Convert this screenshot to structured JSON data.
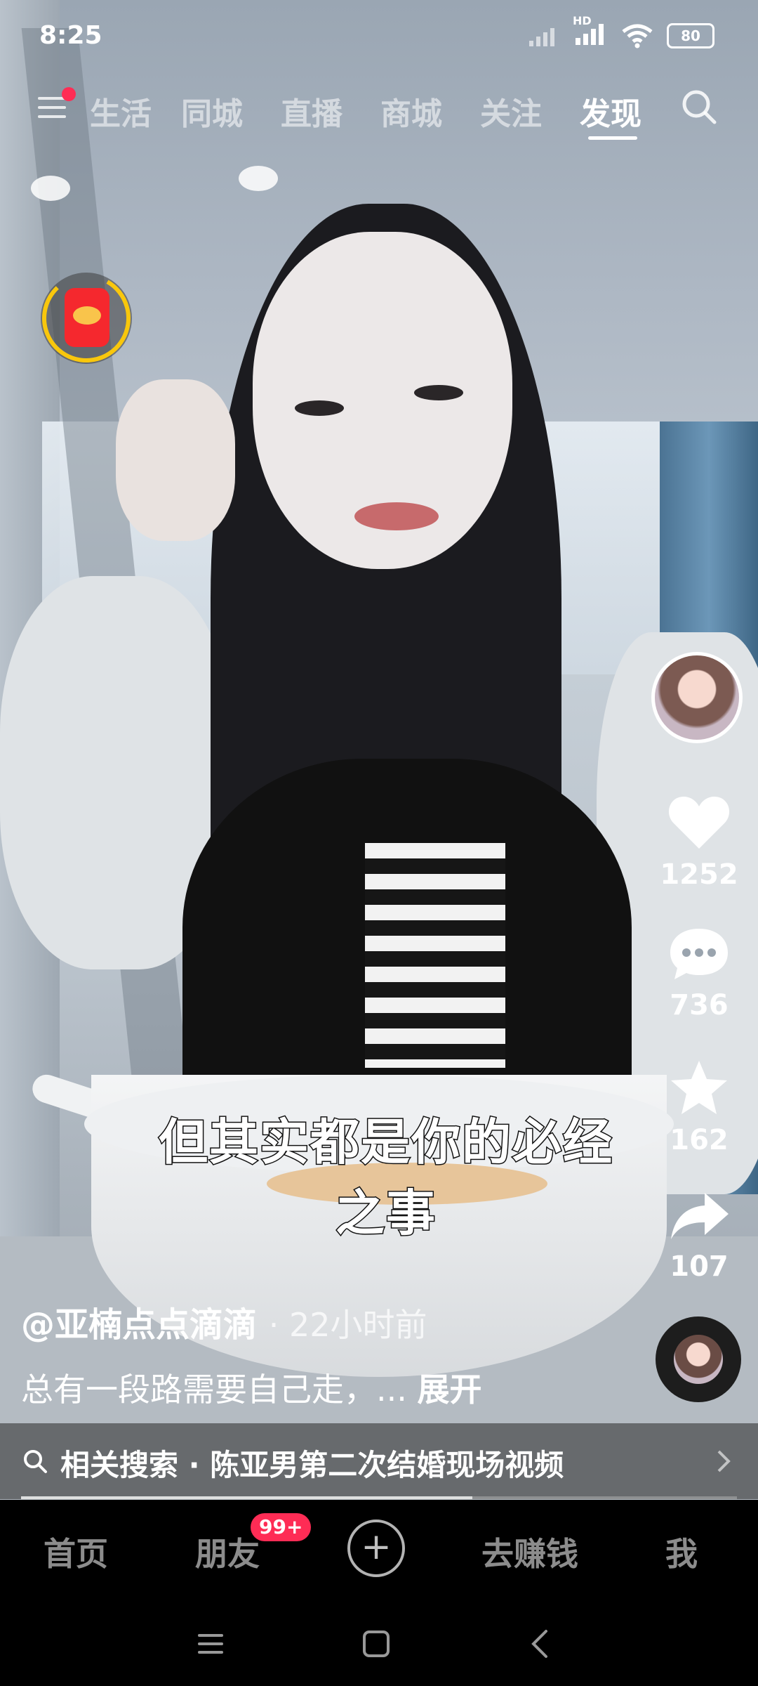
{
  "status_bar": {
    "time": "8:25",
    "network_label": "HD",
    "battery": "80"
  },
  "top_nav": {
    "tabs": [
      {
        "label": "生活",
        "active": false
      },
      {
        "label": "同城",
        "active": false
      },
      {
        "label": "直播",
        "active": false
      },
      {
        "label": "商城",
        "active": false
      },
      {
        "label": "关注",
        "active": false
      },
      {
        "label": "发现",
        "active": true
      }
    ],
    "menu_icon": "menu-icon",
    "search_icon": "search-icon",
    "notification_dot_color": "#ff2d55"
  },
  "video": {
    "subtitle": "但其实都是你的必经之事",
    "author": "@亚楠点点滴滴",
    "time_ago": "· 22小时前",
    "caption": "总有一段路需要自己走，...",
    "expand_label": "展开",
    "progress_fraction": 0.63
  },
  "actions": {
    "like_count": "1252",
    "comment_count": "736",
    "favorite_count": "162",
    "share_count": "107"
  },
  "related_search": {
    "prefix": "相关搜索",
    "separator": "·",
    "query": "陈亚男第二次结婚现场视频"
  },
  "bottom_nav": {
    "home": "首页",
    "friends": "朋友",
    "friends_badge": "99+",
    "earn": "去赚钱",
    "me": "我"
  },
  "colors": {
    "accent_red": "#fe2c55",
    "redpacket_red": "#f5282e",
    "ring_yellow": "#f9c70c"
  }
}
